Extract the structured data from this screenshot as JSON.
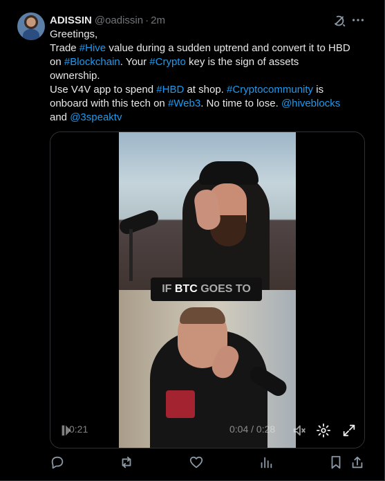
{
  "tweet": {
    "author_name": "ADISSIN",
    "handle": "@oadissin",
    "separator": "·",
    "time": "2m",
    "lines": {
      "l1": "Greetings,",
      "l2a": "Trade ",
      "l2b": "#Hive",
      "l2c": " value during a sudden uptrend and convert it to HBD",
      "l3a": "on ",
      "l3b": "#Blockchain",
      "l3c": ". Your ",
      "l3d": "#Crypto",
      "l3e": " key is the sign of assets",
      "l4": "ownership.",
      "l5a": "Use V4V app to spend ",
      "l5b": "#HBD",
      "l5c": " at shop. ",
      "l5d": "#Cryptocommunity",
      "l5e": " is",
      "l6a": "onboard with this tech on ",
      "l6b": "#Web3",
      "l6c": ". No time to lose. ",
      "l6d": "@hiveblocks",
      "l7a": "and ",
      "l7b": "@3speaktv"
    }
  },
  "video": {
    "caption_prefix": "IF ",
    "caption_strong": "BTC",
    "caption_suffix": " GOES TO",
    "current_time": "0:21",
    "progress_time": "0:04 / 0:28"
  },
  "icons": {
    "grok": "grok-icon",
    "more": "more-icon",
    "play": "play-icon",
    "mute": "mute-icon",
    "settings": "gear-icon",
    "fullscreen": "fullscreen-icon",
    "reply": "reply-icon",
    "repost": "repost-icon",
    "like": "heart-icon",
    "views": "views-icon",
    "bookmark": "bookmark-icon",
    "share": "share-icon"
  },
  "colors": {
    "background": "#000000",
    "text": "#e7e9ea",
    "secondary": "#71767b",
    "link": "#1d9bf0",
    "border": "#2f3336"
  }
}
